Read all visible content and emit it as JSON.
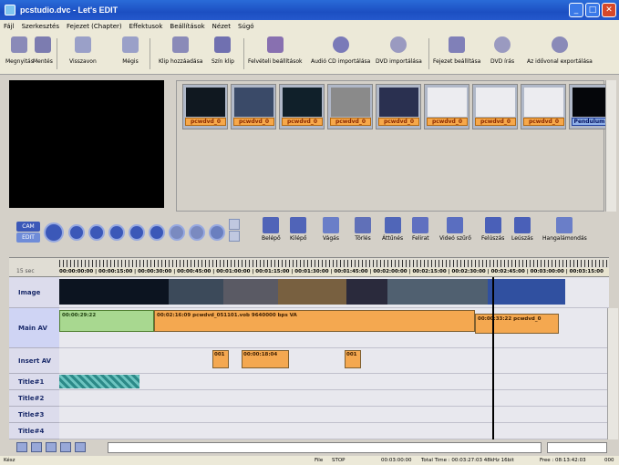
{
  "window": {
    "title": "pcstudio.dvc - Let's EDIT",
    "minimize_icon": "minimize-icon",
    "maximize_icon": "maximize-icon",
    "close_icon": "close-icon"
  },
  "menu": [
    "Fájl",
    "Szerkesztés",
    "Fejezet (Chapter)",
    "Effektusok",
    "Beállítások",
    "Nézet",
    "Súgó"
  ],
  "toolbar": {
    "open": "Megnyitás",
    "save": "Mentés",
    "undo": "Visszavon",
    "redo": "Mégis",
    "add_clip": "Klip hozzáadása",
    "color_clip": "Szín klip",
    "record_settings": "Felvételi beállítások",
    "audio_cd_import": "Audió CD importálása",
    "dvd_import": "DVD importálása",
    "chapter_settings": "Fejezet beállítása",
    "dvd_burn": "DVD írás",
    "timeline_export": "Az idővonal exportálása"
  },
  "clips": [
    {
      "label": "pcwdvd_0",
      "thumb": "#0c1a20"
    },
    {
      "label": "pcwdvd_0",
      "thumb": "#3a4a68"
    },
    {
      "label": "pcwdvd_0",
      "thumb": "#10202a"
    },
    {
      "label": "pcwdvd_0",
      "thumb": "#8a8a8a"
    },
    {
      "label": "pcwdvd_0",
      "thumb": "#2a3050"
    },
    {
      "label": "pcwdvd_0",
      "thumb": "#ececf0"
    },
    {
      "label": "pcwdvd_0",
      "thumb": "#ececf0"
    },
    {
      "label": "pcwdvd_0",
      "thumb": "#ececf0"
    },
    {
      "label": "Pendulum",
      "thumb": "#05060a"
    }
  ],
  "edit_tools": {
    "mark_in": "Belépő",
    "mark_out": "Kilépő",
    "cut": "Vágás",
    "delete": "Törlés",
    "transition": "Áttűnés",
    "title": "Felirat",
    "video_filter": "Videó szűrő",
    "split": "Felúszás",
    "fade_out": "Leúszás",
    "narration": "Hangalámondás"
  },
  "transport": {
    "cam": "CAM",
    "edit": "EDIT"
  },
  "ruler": {
    "scale_label": "15 sec",
    "timecodes": "00:00:00:00 | 00:00:15:00 | 00:00:30:00 | 00:00:45:00 | 00:01:00:00 | 00:01:15:00 | 00:01:30:00 | 00:01:45:00 | 00:02:00:00 | 00:02:15:00 | 00:02:30:00 | 00:02:45:00 | 00:03:00:00 | 00:03:15:00"
  },
  "tracks": {
    "image": "Image",
    "main_av": "Main AV",
    "insert_av": "Insert AV",
    "title1": "Title#1",
    "title2": "Title#2",
    "title3": "Title#3",
    "title4": "Title#4"
  },
  "main_av": {
    "seg1": "00:00:29:22",
    "seg2": "00:02:16:09   pcwdvd_051101.vob   9640000 bps   VA",
    "seg3": "00:00:33:22   pcwdvd_0"
  },
  "insert_av": {
    "seg1": "001",
    "seg2": "00:00:18:04",
    "seg3": "001"
  },
  "status": {
    "ready": "Kész",
    "file_state": "File",
    "stop": "STOP",
    "position": "00:03:00:00",
    "total_time": "Total Time : 00:03:27:03 48kHz 16bit",
    "free": "Free : 08:13:42:03",
    "extra": "000"
  }
}
